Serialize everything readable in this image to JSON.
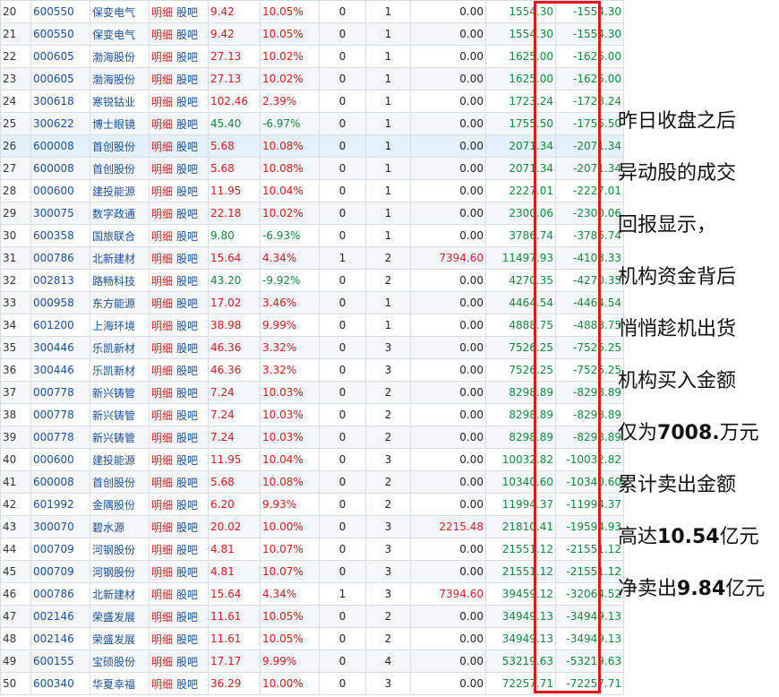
{
  "table": {
    "rows": [
      {
        "idx": "20",
        "code": "600550",
        "name": "保变电气",
        "link1": "明细",
        "link2": "股吧",
        "price": "9.42",
        "pct": "10.05%",
        "dir": "up",
        "n1": "0",
        "n2": "1",
        "buy": "0.00",
        "sell": "1554.30",
        "net": "-1554.30"
      },
      {
        "idx": "21",
        "code": "600550",
        "name": "保变电气",
        "link1": "明细",
        "link2": "股吧",
        "price": "9.42",
        "pct": "10.05%",
        "dir": "up",
        "n1": "0",
        "n2": "1",
        "buy": "0.00",
        "sell": "1554.30",
        "net": "-1554.30"
      },
      {
        "idx": "22",
        "code": "000605",
        "name": "渤海股份",
        "link1": "明细",
        "link2": "股吧",
        "price": "27.13",
        "pct": "10.02%",
        "dir": "up",
        "n1": "0",
        "n2": "1",
        "buy": "0.00",
        "sell": "1625.00",
        "net": "-1625.00"
      },
      {
        "idx": "23",
        "code": "000605",
        "name": "渤海股份",
        "link1": "明细",
        "link2": "股吧",
        "price": "27.13",
        "pct": "10.02%",
        "dir": "up",
        "n1": "0",
        "n2": "1",
        "buy": "0.00",
        "sell": "1625.00",
        "net": "-1625.00"
      },
      {
        "idx": "24",
        "code": "300618",
        "name": "寒锐钴业",
        "link1": "明细",
        "link2": "股吧",
        "price": "102.46",
        "pct": "2.39%",
        "dir": "up",
        "n1": "0",
        "n2": "1",
        "buy": "0.00",
        "sell": "1723.24",
        "net": "-1723.24"
      },
      {
        "idx": "25",
        "code": "300622",
        "name": "博士眼镜",
        "link1": "明细",
        "link2": "股吧",
        "price": "45.40",
        "pct": "-6.97%",
        "dir": "down",
        "n1": "0",
        "n2": "1",
        "buy": "0.00",
        "sell": "1755.50",
        "net": "-1755.50"
      },
      {
        "idx": "26",
        "code": "600008",
        "name": "首创股份",
        "link1": "明细",
        "link2": "股吧",
        "price": "5.68",
        "pct": "10.08%",
        "dir": "up",
        "n1": "0",
        "n2": "1",
        "buy": "0.00",
        "sell": "2071.34",
        "net": "-2071.34",
        "hl": true
      },
      {
        "idx": "27",
        "code": "600008",
        "name": "首创股份",
        "link1": "明细",
        "link2": "股吧",
        "price": "5.68",
        "pct": "10.08%",
        "dir": "up",
        "n1": "0",
        "n2": "1",
        "buy": "0.00",
        "sell": "2071.34",
        "net": "-2071.34"
      },
      {
        "idx": "28",
        "code": "000600",
        "name": "建投能源",
        "link1": "明细",
        "link2": "股吧",
        "price": "11.95",
        "pct": "10.04%",
        "dir": "up",
        "n1": "0",
        "n2": "1",
        "buy": "0.00",
        "sell": "2227.01",
        "net": "-2227.01"
      },
      {
        "idx": "29",
        "code": "300075",
        "name": "数字政通",
        "link1": "明细",
        "link2": "股吧",
        "price": "22.18",
        "pct": "10.02%",
        "dir": "up",
        "n1": "0",
        "n2": "1",
        "buy": "0.00",
        "sell": "2300.06",
        "net": "-2300.06"
      },
      {
        "idx": "30",
        "code": "600358",
        "name": "国旅联合",
        "link1": "明细",
        "link2": "股吧",
        "price": "9.80",
        "pct": "-6.93%",
        "dir": "down",
        "n1": "0",
        "n2": "1",
        "buy": "0.00",
        "sell": "3786.74",
        "net": "-3786.74"
      },
      {
        "idx": "31",
        "code": "000786",
        "name": "北新建材",
        "link1": "明细",
        "link2": "股吧",
        "price": "15.64",
        "pct": "4.34%",
        "dir": "up",
        "n1": "1",
        "n2": "2",
        "buy": "7394.60",
        "sell": "11497.93",
        "net": "-4103.33"
      },
      {
        "idx": "32",
        "code": "002813",
        "name": "路畅科技",
        "link1": "明细",
        "link2": "股吧",
        "price": "43.20",
        "pct": "-9.92%",
        "dir": "down",
        "n1": "0",
        "n2": "2",
        "buy": "0.00",
        "sell": "4270.35",
        "net": "-4270.35"
      },
      {
        "idx": "33",
        "code": "000958",
        "name": "东方能源",
        "link1": "明细",
        "link2": "股吧",
        "price": "17.02",
        "pct": "3.46%",
        "dir": "up",
        "n1": "0",
        "n2": "1",
        "buy": "0.00",
        "sell": "4464.54",
        "net": "-4464.54"
      },
      {
        "idx": "34",
        "code": "601200",
        "name": "上海环境",
        "link1": "明细",
        "link2": "股吧",
        "price": "38.98",
        "pct": "9.99%",
        "dir": "up",
        "n1": "0",
        "n2": "1",
        "buy": "0.00",
        "sell": "4888.75",
        "net": "-4888.75"
      },
      {
        "idx": "35",
        "code": "300446",
        "name": "乐凯新材",
        "link1": "明细",
        "link2": "股吧",
        "price": "46.36",
        "pct": "3.32%",
        "dir": "up",
        "n1": "0",
        "n2": "3",
        "buy": "0.00",
        "sell": "7526.25",
        "net": "-7526.25"
      },
      {
        "idx": "36",
        "code": "300446",
        "name": "乐凯新材",
        "link1": "明细",
        "link2": "股吧",
        "price": "46.36",
        "pct": "3.32%",
        "dir": "up",
        "n1": "0",
        "n2": "3",
        "buy": "0.00",
        "sell": "7526.25",
        "net": "-7526.25"
      },
      {
        "idx": "37",
        "code": "000778",
        "name": "新兴铸管",
        "link1": "明细",
        "link2": "股吧",
        "price": "7.24",
        "pct": "10.03%",
        "dir": "up",
        "n1": "0",
        "n2": "2",
        "buy": "0.00",
        "sell": "8298.89",
        "net": "-8298.89"
      },
      {
        "idx": "38",
        "code": "000778",
        "name": "新兴铸管",
        "link1": "明细",
        "link2": "股吧",
        "price": "7.24",
        "pct": "10.03%",
        "dir": "up",
        "n1": "0",
        "n2": "2",
        "buy": "0.00",
        "sell": "8298.89",
        "net": "-8298.89"
      },
      {
        "idx": "39",
        "code": "000778",
        "name": "新兴铸管",
        "link1": "明细",
        "link2": "股吧",
        "price": "7.24",
        "pct": "10.03%",
        "dir": "up",
        "n1": "0",
        "n2": "2",
        "buy": "0.00",
        "sell": "8298.89",
        "net": "-8298.89"
      },
      {
        "idx": "40",
        "code": "000600",
        "name": "建投能源",
        "link1": "明细",
        "link2": "股吧",
        "price": "11.95",
        "pct": "10.04%",
        "dir": "up",
        "n1": "0",
        "n2": "3",
        "buy": "0.00",
        "sell": "10032.82",
        "net": "-10032.82"
      },
      {
        "idx": "41",
        "code": "600008",
        "name": "首创股份",
        "link1": "明细",
        "link2": "股吧",
        "price": "5.68",
        "pct": "10.08%",
        "dir": "up",
        "n1": "0",
        "n2": "2",
        "buy": "0.00",
        "sell": "10340.60",
        "net": "-10340.60"
      },
      {
        "idx": "42",
        "code": "601992",
        "name": "金隅股份",
        "link1": "明细",
        "link2": "股吧",
        "price": "6.20",
        "pct": "9.93%",
        "dir": "up",
        "n1": "0",
        "n2": "2",
        "buy": "0.00",
        "sell": "11994.37",
        "net": "-11994.37"
      },
      {
        "idx": "43",
        "code": "300070",
        "name": "碧水源",
        "link1": "明细",
        "link2": "股吧",
        "price": "20.02",
        "pct": "10.00%",
        "dir": "up",
        "n1": "0",
        "n2": "3",
        "buy": "2215.48",
        "sell": "21810.41",
        "net": "-19594.93"
      },
      {
        "idx": "44",
        "code": "000709",
        "name": "河钢股份",
        "link1": "明细",
        "link2": "股吧",
        "price": "4.81",
        "pct": "10.07%",
        "dir": "up",
        "n1": "0",
        "n2": "3",
        "buy": "0.00",
        "sell": "21551.12",
        "net": "-21551.12"
      },
      {
        "idx": "45",
        "code": "000709",
        "name": "河钢股份",
        "link1": "明细",
        "link2": "股吧",
        "price": "4.81",
        "pct": "10.07%",
        "dir": "up",
        "n1": "0",
        "n2": "3",
        "buy": "0.00",
        "sell": "21551.12",
        "net": "-21551.12"
      },
      {
        "idx": "46",
        "code": "000786",
        "name": "北新建材",
        "link1": "明细",
        "link2": "股吧",
        "price": "15.64",
        "pct": "4.34%",
        "dir": "up",
        "n1": "1",
        "n2": "3",
        "buy": "7394.60",
        "sell": "39459.12",
        "net": "-32064.52"
      },
      {
        "idx": "47",
        "code": "002146",
        "name": "荣盛发展",
        "link1": "明细",
        "link2": "股吧",
        "price": "11.61",
        "pct": "10.05%",
        "dir": "up",
        "n1": "0",
        "n2": "2",
        "buy": "0.00",
        "sell": "34949.13",
        "net": "-34949.13"
      },
      {
        "idx": "48",
        "code": "002146",
        "name": "荣盛发展",
        "link1": "明细",
        "link2": "股吧",
        "price": "11.61",
        "pct": "10.05%",
        "dir": "up",
        "n1": "0",
        "n2": "2",
        "buy": "0.00",
        "sell": "34949.13",
        "net": "-34949.13"
      },
      {
        "idx": "49",
        "code": "600155",
        "name": "宝硕股份",
        "link1": "明细",
        "link2": "股吧",
        "price": "17.17",
        "pct": "9.99%",
        "dir": "up",
        "n1": "0",
        "n2": "4",
        "buy": "0.00",
        "sell": "53219.63",
        "net": "-53219.63"
      },
      {
        "idx": "50",
        "code": "600340",
        "name": "华夏幸福",
        "link1": "明细",
        "link2": "股吧",
        "price": "36.29",
        "pct": "10.00%",
        "dir": "up",
        "n1": "0",
        "n2": "3",
        "buy": "0.00",
        "sell": "72257.71",
        "net": "-72257.71"
      }
    ]
  },
  "colors": {
    "up": "#e01818",
    "down": "#11883a",
    "link": "#1a4f9a",
    "highlight_box": "#e8141c"
  },
  "notes": {
    "lines": [
      {
        "pre": "昨日收盘之后",
        "bold": "",
        "post": ""
      },
      {
        "pre": "异动股的成交",
        "bold": "",
        "post": ""
      },
      {
        "pre": "回报显示，",
        "bold": "",
        "post": ""
      },
      {
        "pre": "机构资金背后",
        "bold": "",
        "post": ""
      },
      {
        "pre": "悄悄趁机出货",
        "bold": "",
        "post": ""
      },
      {
        "pre": "机构买入金额",
        "bold": "",
        "post": ""
      },
      {
        "pre": "仅为",
        "bold": "7008.",
        "post": "万元"
      },
      {
        "pre": "累计卖出金额",
        "bold": "",
        "post": ""
      },
      {
        "pre": "高达",
        "bold": "10.54",
        "post": "亿元"
      },
      {
        "pre": "净卖出",
        "bold": "9.84",
        "post": "亿元"
      }
    ]
  }
}
